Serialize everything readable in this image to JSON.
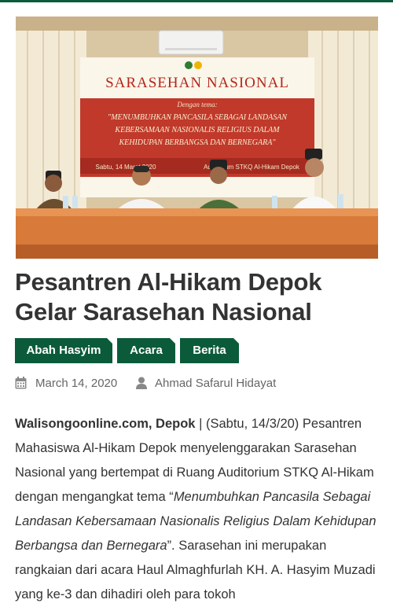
{
  "hero": {
    "banner_heading": "SARASEHAN NASIONAL",
    "banner_sub": "Dengan tema:",
    "banner_theme_lines": [
      "\"MENUMBUHKAN PANCASILA SEBAGAI LANDASAN",
      "KEBERSAMAAN NASIONALIS RELIGIUS DALAM",
      "KEHIDUPAN BERBANGSA DAN BERNEGARA\""
    ],
    "banner_date": "Sabtu, 14 Maret 2020",
    "banner_place": "Auditorium STKQ Al-Hikam Depok"
  },
  "article": {
    "title": "Pesantren Al-Hikam Depok Gelar Sarasehan Nasional",
    "tags": [
      "Abah Hasyim",
      "Acara",
      "Berita"
    ],
    "date": "March 14, 2020",
    "author": "Ahmad Safarul Hidayat",
    "body": {
      "source": "Walisongoonline.com, Depok",
      "sep": " | ",
      "p1": "(Sabtu, 14/3/20) Pesantren Mahasiswa Al-Hikam Depok menyelenggarakan Sarasehan Nasional yang bertempat di Ruang Auditorium STKQ Al-Hikam dengan mengangkat tema “",
      "theme": "Menumbuhkan Pancasila Sebagai Landasan Kebersamaan Nasionalis Religius Dalam Kehidupan Berbangsa dan Bernegara",
      "p2": "”. Sarasehan ini merupakan rangkaian dari acara Haul Almaghfurlah KH. A. Hasyim Muzadi yang ke-3 dan dihadiri oleh para tokoh"
    }
  },
  "colors": {
    "brand_green": "#0b5b3a"
  },
  "icons": {
    "date": "calendar-icon",
    "author": "user-icon"
  }
}
